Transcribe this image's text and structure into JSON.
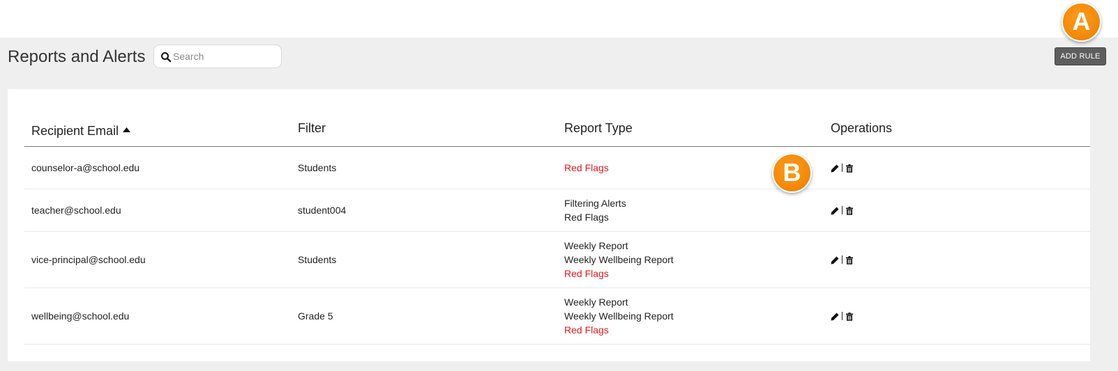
{
  "page": {
    "title": "Reports and Alerts"
  },
  "search": {
    "placeholder": "Search",
    "value": "",
    "icon": "search-icon"
  },
  "toolbar": {
    "add_rule_label": "ADD RULE"
  },
  "table": {
    "columns": [
      "Recipient Email",
      "Filter",
      "Report Type",
      "Operations"
    ],
    "sort": {
      "column": "Recipient Email",
      "direction": "ascending"
    },
    "rows": [
      {
        "email": "counselor-a@school.edu",
        "filter": "Students",
        "report_types": [
          {
            "label": "Red Flags",
            "color": "#e0191e"
          }
        ]
      },
      {
        "email": "teacher@school.edu",
        "filter": "student004",
        "report_types": [
          {
            "label": "Filtering Alerts"
          },
          {
            "label": "Red Flags"
          }
        ]
      },
      {
        "email": "vice-principal@school.edu",
        "filter": "Students",
        "report_types": [
          {
            "label": "Weekly Report"
          },
          {
            "label": "Weekly Wellbeing Report"
          },
          {
            "label": "Red Flags",
            "color": "#e0191e"
          }
        ]
      },
      {
        "email": "wellbeing@school.edu",
        "filter": "Grade 5",
        "report_types": [
          {
            "label": "Weekly Report"
          },
          {
            "label": "Weekly Wellbeing Report"
          },
          {
            "label": "Red Flags",
            "color": "#e0191e"
          }
        ]
      }
    ],
    "operation_icons": [
      "pencil-icon",
      "trash-icon"
    ]
  },
  "callouts": {
    "a": "A",
    "b": "B"
  },
  "colors": {
    "accent_red": "#e0191e",
    "callout_orange": "#f48a0a",
    "button_gray": "#5e5e5e"
  }
}
